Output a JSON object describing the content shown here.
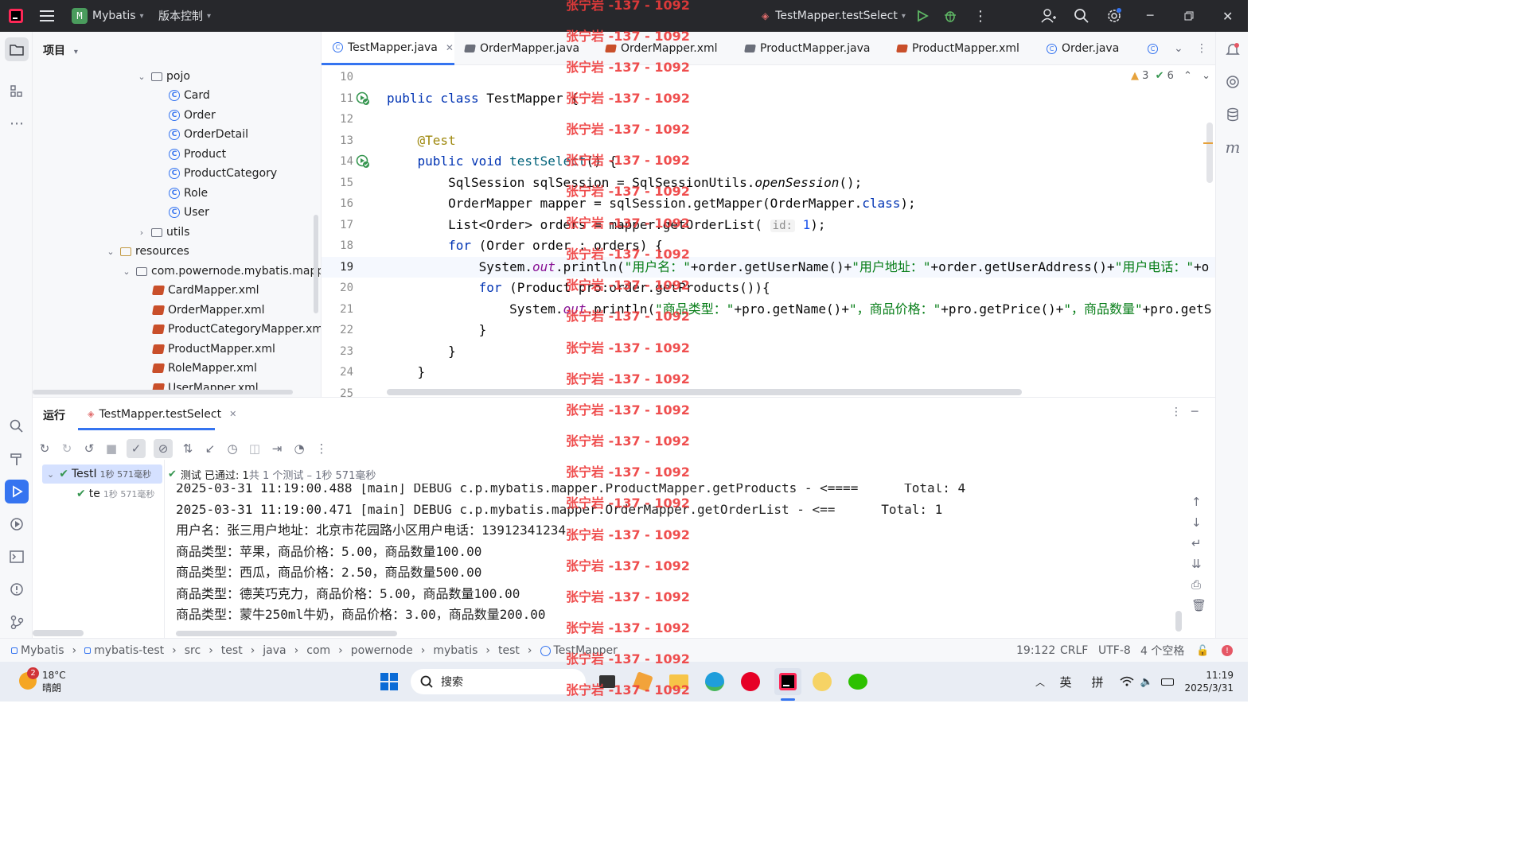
{
  "titlebar": {
    "project_badge": "M",
    "project_name": "Mybatis",
    "vcs_menu": "版本控制",
    "run_config": "TestMapper.testSelect"
  },
  "project_panel": {
    "title": "项目",
    "items": [
      {
        "label": "pojo",
        "kind": "package"
      },
      {
        "label": "Card",
        "kind": "class"
      },
      {
        "label": "Order",
        "kind": "class"
      },
      {
        "label": "OrderDetail",
        "kind": "class"
      },
      {
        "label": "Product",
        "kind": "class"
      },
      {
        "label": "ProductCategory",
        "kind": "class"
      },
      {
        "label": "Role",
        "kind": "class"
      },
      {
        "label": "User",
        "kind": "class"
      },
      {
        "label": "utils",
        "kind": "package"
      },
      {
        "label": "resources",
        "kind": "folder"
      },
      {
        "label": "com.powernode.mybatis.mapper",
        "kind": "folder"
      },
      {
        "label": "CardMapper.xml",
        "kind": "xml"
      },
      {
        "label": "OrderMapper.xml",
        "kind": "xml"
      },
      {
        "label": "ProductCategoryMapper.xml",
        "kind": "xml"
      },
      {
        "label": "ProductMapper.xml",
        "kind": "xml"
      },
      {
        "label": "RoleMapper.xml",
        "kind": "xml"
      },
      {
        "label": "UserMapper.xml",
        "kind": "xml"
      }
    ]
  },
  "tabs": [
    {
      "label": "TestMapper.java",
      "active": true
    },
    {
      "label": "OrderMapper.java"
    },
    {
      "label": "OrderMapper.xml"
    },
    {
      "label": "ProductMapper.java"
    },
    {
      "label": "ProductMapper.xml"
    },
    {
      "label": "Order.java"
    }
  ],
  "inspections": {
    "warnings": "3",
    "checks": "6"
  },
  "editor": {
    "line_numbers": [
      "10",
      "11",
      "12",
      "13",
      "14",
      "15",
      "16",
      "17",
      "18",
      "19",
      "20",
      "21",
      "22",
      "23",
      "24",
      "25"
    ],
    "current_line": "19"
  },
  "run_panel": {
    "title": "运行",
    "config_tab": "TestMapper.testSelect",
    "tree_root": "TestI",
    "tree_root_time": "1秒 571毫秒",
    "tree_child": "te",
    "tree_child_time": "1秒 571毫秒",
    "result_summary": "测试 已通过: 1",
    "result_detail": "共 1 个测试 – 1秒 571毫秒",
    "console_lines": [
      "2025-03-31 11:19:00.488 [main] DEBUG c.p.mybatis.mapper.ProductMapper.getProducts - <====      Total: 4",
      "2025-03-31 11:19:00.471 [main] DEBUG c.p.mybatis.mapper.OrderMapper.getOrderList - <==      Total: 1",
      "用户名：张三用户地址：北京市花园路小区用户电话：13912341234",
      "商品类型：苹果，商品价格：5.00，商品数量100.00",
      "商品类型：西瓜，商品价格：2.50，商品数量500.00",
      "商品类型：德芙巧克力，商品价格：5.00，商品数量100.00",
      "商品类型：蒙牛250ml牛奶，商品价格：3.00，商品数量200.00"
    ]
  },
  "breadcrumb": [
    "Mybatis",
    "mybatis-test",
    "src",
    "test",
    "java",
    "com",
    "powernode",
    "mybatis",
    "test",
    "TestMapper"
  ],
  "status": {
    "position": "19:122",
    "line_sep": "CRLF",
    "encoding": "UTF-8",
    "indent": "4 个空格"
  },
  "taskbar": {
    "weather_temp": "18°C",
    "weather_desc": "晴朗",
    "weather_badge": "2",
    "search_placeholder": "搜索",
    "ime_lang": "英",
    "ime_mode": "拼",
    "time": "11:19",
    "date": "2025/3/31"
  },
  "watermark": "张宁岩 -137 - 1092",
  "colors": {
    "accent": "#3574f0",
    "watermark": "#ee3b3b",
    "success": "#369650"
  }
}
